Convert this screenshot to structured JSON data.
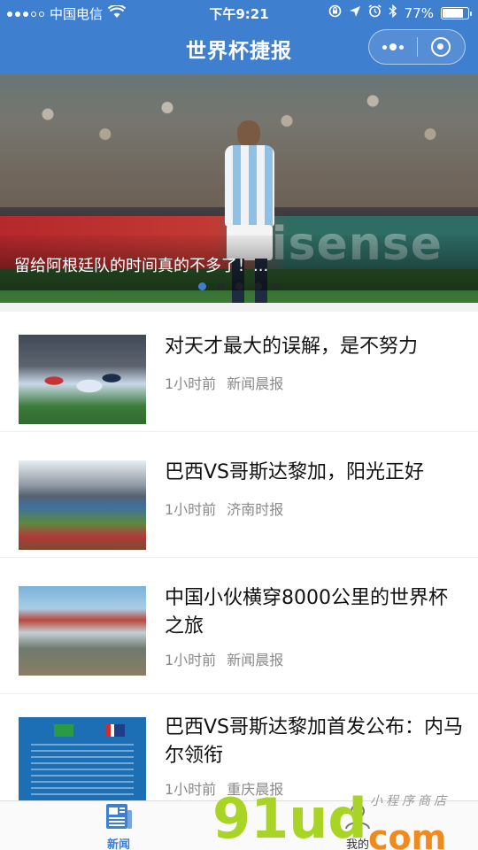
{
  "status_bar": {
    "carrier": "中国电信",
    "time": "下午9:21",
    "battery_percent": "77%",
    "battery_level": 0.77
  },
  "nav": {
    "title": "世界杯捷报"
  },
  "banner": {
    "caption": "留给阿根廷队的时间真的不多了！...",
    "ad_text": "Hisense",
    "indicator_count": 5,
    "active_index": 0
  },
  "news": [
    {
      "title": "对天才最大的误解，是不努力",
      "time": "1小时前",
      "source": "新闻晨报"
    },
    {
      "title": "巴西VS哥斯达黎加，阳光正好",
      "time": "1小时前",
      "source": "济南时报"
    },
    {
      "title": "中国小伙横穿8000公里的世界杯之旅",
      "time": "1小时前",
      "source": "新闻晨报"
    },
    {
      "title": "巴西VS哥斯达黎加首发公布：内马尔领衔",
      "time": "1小时前",
      "source": "重庆晨报"
    }
  ],
  "tabbar": {
    "news_label": "新闻",
    "mine_label": "我的"
  },
  "watermark": {
    "main": "91ud",
    "sub": "com",
    "shop": "小程序商店"
  },
  "colors": {
    "primary": "#3f7fd0",
    "meta_text": "#8a8a8a",
    "watermark_green": "#a7d425",
    "watermark_orange": "#f08a1c"
  },
  "icons": {
    "wifi": "wifi-icon",
    "rotation_lock": "rotation-lock-icon",
    "location": "location-arrow-icon",
    "alarm": "alarm-icon",
    "bluetooth": "bluetooth-icon",
    "battery": "battery-icon",
    "more": "more-dots-icon",
    "close": "close-target-icon",
    "news_tab": "newspaper-icon",
    "mine_tab": "person-icon"
  }
}
